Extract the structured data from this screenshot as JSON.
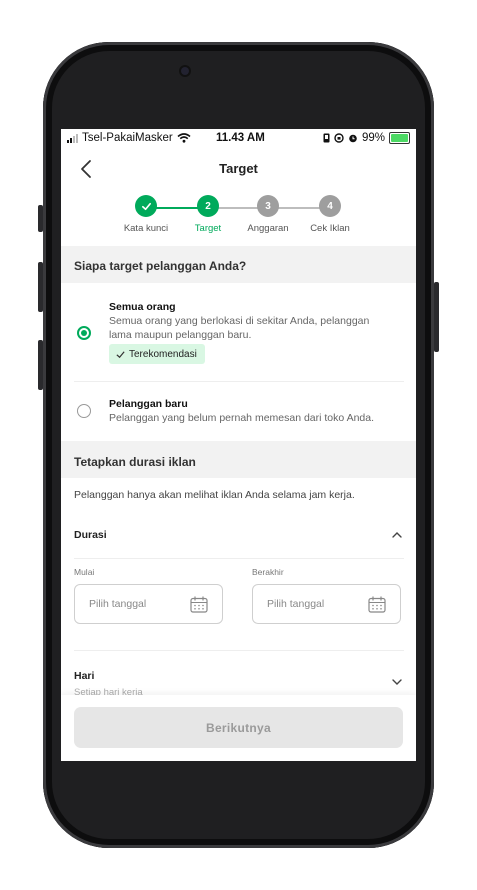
{
  "status_bar": {
    "carrier": "Tsel-PakaiMasker",
    "time": "11.43 AM",
    "battery": "99%",
    "battery_level": 0.99
  },
  "header": {
    "title": "Target",
    "back_icon": "chevron-left-icon"
  },
  "stepper": {
    "current_step": 2,
    "steps": [
      {
        "number": "1",
        "label": "Kata kunci",
        "state": "done"
      },
      {
        "number": "2",
        "label": "Target",
        "state": "active"
      },
      {
        "number": "3",
        "label": "Anggaran",
        "state": "todo"
      },
      {
        "number": "4",
        "label": "Cek Iklan",
        "state": "todo"
      }
    ]
  },
  "target_section": {
    "heading": "Siapa target pelanggan Anda?",
    "options": [
      {
        "title": "Semua orang",
        "description": "Semua orang yang berlokasi di sekitar Anda, pelanggan lama maupun pelanggan baru.",
        "badge": "Terekomendasi",
        "selected": true
      },
      {
        "title": "Pelanggan baru",
        "description": "Pelanggan yang belum pernah memesan dari toko Anda.",
        "selected": false
      }
    ]
  },
  "duration_section": {
    "heading": "Tetapkan durasi iklan",
    "note": "Pelanggan hanya akan melihat iklan Anda selama jam kerja.",
    "duration": {
      "label": "Durasi",
      "expanded": true,
      "start_label": "Mulai",
      "start_placeholder": "Pilih tanggal",
      "end_label": "Berakhir",
      "end_placeholder": "Pilih tanggal"
    },
    "days": {
      "label": "Hari",
      "value": "Setiap hari kerja",
      "expanded": false
    }
  },
  "footer": {
    "next_label": "Berikutnya",
    "enabled": false
  },
  "colors": {
    "accent": "#00aa5b",
    "step_inactive": "#9e9e9e",
    "badge_bg": "#d9f7e3",
    "section_bg": "#f2f2f2",
    "button_disabled_bg": "#e6e6e6"
  }
}
